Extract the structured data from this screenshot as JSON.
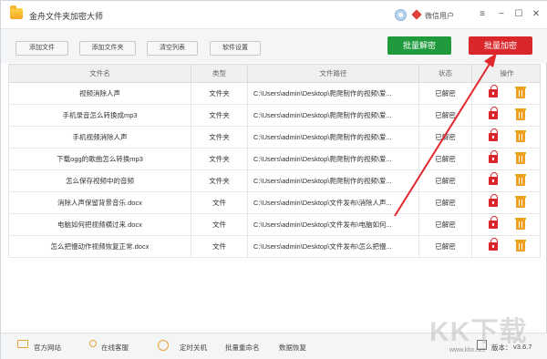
{
  "window": {
    "title": "金舟文件夹加密大师",
    "user_name": "微信用户",
    "minimize": "−",
    "maximize": "☐",
    "close": "✕",
    "menu": "≡"
  },
  "toolbar": {
    "add_file": "添加文件",
    "add_folder": "添加文件夹",
    "clear_list": "清空列表",
    "settings": "软件设置",
    "batch_decrypt": "批量解密",
    "batch_encrypt": "批量加密"
  },
  "colors": {
    "decrypt_green": "#1f9b3d",
    "encrypt_red": "#d9272b",
    "lock_red": "#d8262b",
    "trash_orange": "#f0a020",
    "annotation_red": "#e0282d"
  },
  "table": {
    "headers": [
      "文件名",
      "类型",
      "文件路径",
      "状态",
      "操作"
    ],
    "rows": [
      {
        "name": "视频消除人声",
        "type": "文件夹",
        "path": "C:\\Users\\admin\\Desktop\\爬爬制作的视频\\爱...",
        "status": "已解密"
      },
      {
        "name": "手机录音怎么转换成mp3",
        "type": "文件夹",
        "path": "C:\\Users\\admin\\Desktop\\爬爬制作的视频\\爱...",
        "status": "已解密"
      },
      {
        "name": "手机视频消除人声",
        "type": "文件夹",
        "path": "C:\\Users\\admin\\Desktop\\爬爬制作的视频\\爱...",
        "status": "已解密"
      },
      {
        "name": "下载ogg的歌曲怎么转换mp3",
        "type": "文件夹",
        "path": "C:\\Users\\admin\\Desktop\\爬爬制作的视频\\爱...",
        "status": "已解密"
      },
      {
        "name": "怎么保存视频中的音频",
        "type": "文件夹",
        "path": "C:\\Users\\admin\\Desktop\\爬爬制作的视频\\爱...",
        "status": "已解密"
      },
      {
        "name": "消除人声保留背景音乐.docx",
        "type": "文件",
        "path": "C:\\Users\\admin\\Desktop\\文件发布\\消除人声...",
        "status": "已解密"
      },
      {
        "name": "电脑如何把视频横过来.docx",
        "type": "文件",
        "path": "C:\\Users\\admin\\Desktop\\文件发布\\电脑如何...",
        "status": "已解密"
      },
      {
        "name": "怎么把慢动作视频恢复正常.docx",
        "type": "文件",
        "path": "C:\\Users\\admin\\Desktop\\文件发布\\怎么把慢...",
        "status": "已解密"
      }
    ],
    "op_icons": [
      "lock-icon",
      "trash-icon"
    ]
  },
  "footer": {
    "official_site": "官方网站",
    "online_service": "在线客服",
    "timed_shutdown": "定时关机",
    "batch_rename": "批量重命名",
    "data_recovery": "数据恢复",
    "version_label": "版本：",
    "version": "v3.6.7"
  },
  "watermark": {
    "text": "KK下载",
    "url": "www.kkx.net"
  }
}
